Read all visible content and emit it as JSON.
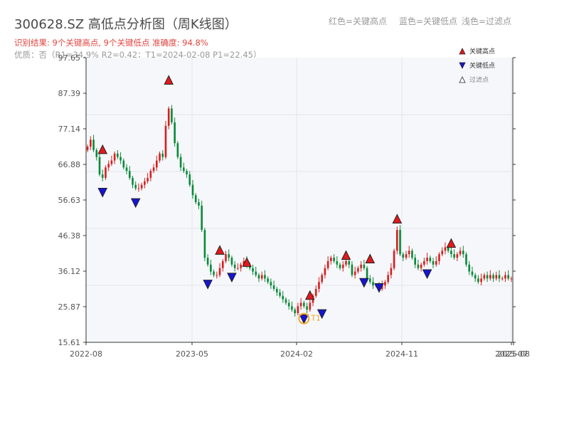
{
  "header": {
    "title": "300628.SZ 高低点分析图（周K线图）",
    "result_line": "识别结果: 9个关键高点, 9个关键低点  准确度: 94.8%",
    "quality_line": "优质：否（R1=34.9%  R2=0.42；T1=2024-02-08 P1=22.45）",
    "legend_red": "红色=关键高点",
    "legend_blue": "蓝色=关键低点",
    "legend_light": "浅色=过滤点"
  },
  "colors": {
    "up": "#d81e1e",
    "down": "#0a8a3a",
    "high_marker": "#e3191c",
    "low_marker": "#1515d4",
    "t1_ring": "#f5a623",
    "plot_bg": "#f6f7fa",
    "grid": "#e3e6ec"
  },
  "chart_data": {
    "type": "candlestick",
    "x_tick_labels": [
      "2022-08",
      "2023-05",
      "2024-02",
      "2024-11",
      "2025-07",
      "2025-08"
    ],
    "y_ticks": [
      15.61,
      25.87,
      36.12,
      46.38,
      56.63,
      66.88,
      77.14,
      87.39,
      97.65
    ],
    "ylim": [
      15.61,
      97.65
    ],
    "grid": true,
    "legend": {
      "position": "top-right",
      "items": [
        {
          "label": "关键高点",
          "marker": "triangle-up-red"
        },
        {
          "label": "关键低点",
          "marker": "triangle-down-blue"
        },
        {
          "label": "过滤点",
          "marker": "triangle-up-outline"
        }
      ]
    },
    "candles_close": [
      72,
      74,
      71,
      69,
      64,
      63,
      66,
      67,
      68,
      70,
      69,
      68,
      66,
      65,
      63,
      61,
      60,
      60,
      61,
      62,
      63,
      65,
      66,
      68,
      70,
      69,
      78,
      83,
      79,
      73,
      69,
      66,
      65,
      64,
      61,
      58,
      56,
      55,
      48,
      40,
      38,
      36,
      35,
      35,
      37,
      39,
      41,
      40,
      38,
      37,
      37,
      38,
      39,
      38,
      37,
      36,
      35,
      34,
      35,
      34,
      33,
      32,
      31,
      30,
      29,
      28,
      27,
      26,
      25,
      24,
      26,
      27,
      26,
      25,
      27,
      29,
      31,
      33,
      35,
      37,
      39,
      40,
      39,
      38,
      37,
      38,
      39,
      38,
      35,
      36,
      37,
      38,
      37,
      34,
      33,
      32,
      32,
      31,
      32,
      33,
      35,
      37,
      42,
      48,
      41,
      40,
      41,
      42,
      40,
      38,
      37,
      38,
      39,
      40,
      39,
      38,
      39,
      41,
      42,
      43,
      42,
      41,
      40,
      41,
      42,
      41,
      38,
      36,
      35,
      34,
      33,
      34,
      35,
      34,
      35,
      34,
      35,
      34,
      34,
      35,
      34,
      34
    ],
    "key_highs": [
      {
        "index": 5,
        "price": 71
      },
      {
        "index": 27,
        "price": 91
      },
      {
        "index": 44,
        "price": 42
      },
      {
        "index": 53,
        "price": 38.5
      },
      {
        "index": 74,
        "price": 29
      },
      {
        "index": 86,
        "price": 40.5
      },
      {
        "index": 94,
        "price": 39.5
      },
      {
        "index": 103,
        "price": 51
      },
      {
        "index": 121,
        "price": 44
      }
    ],
    "key_lows": [
      {
        "index": 5,
        "price": 59
      },
      {
        "index": 16,
        "price": 56
      },
      {
        "index": 40,
        "price": 32.5
      },
      {
        "index": 48,
        "price": 34.5
      },
      {
        "index": 72,
        "price": 22.5
      },
      {
        "index": 78,
        "price": 24
      },
      {
        "index": 92,
        "price": 33
      },
      {
        "index": 97,
        "price": 31.5
      },
      {
        "index": 113,
        "price": 35.5
      }
    ],
    "t1_point": {
      "index": 72,
      "price": 22.45,
      "label": "T1"
    }
  }
}
